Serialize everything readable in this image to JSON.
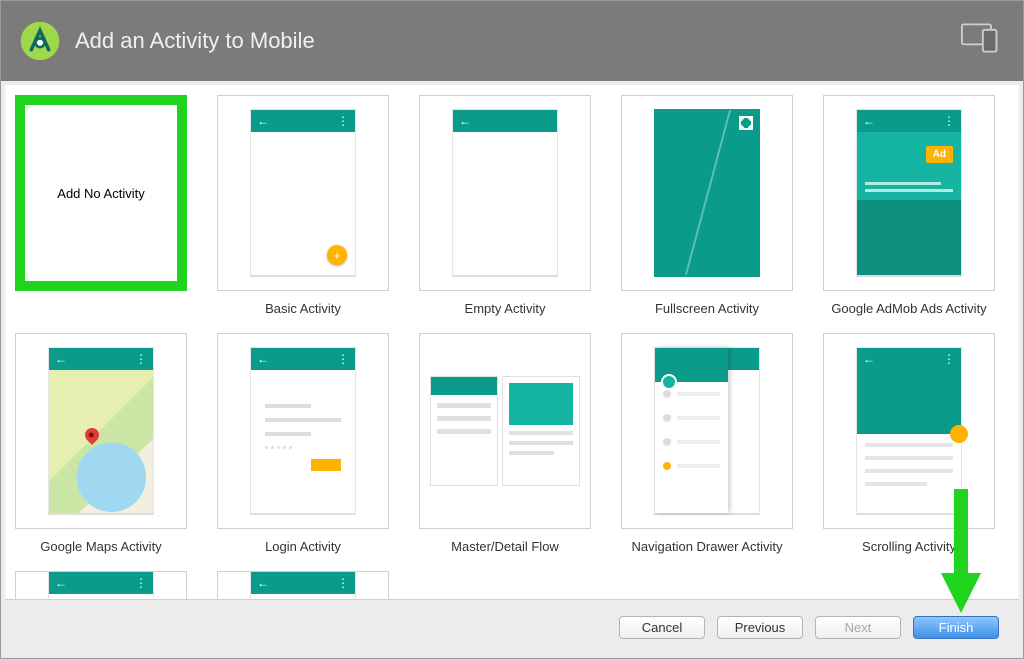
{
  "header": {
    "title": "Add an Activity to Mobile"
  },
  "tiles": [
    {
      "label": "",
      "inside": "Add No Activity",
      "type": "blank",
      "selected": true
    },
    {
      "label": "Basic Activity",
      "type": "basic"
    },
    {
      "label": "Empty Activity",
      "type": "empty"
    },
    {
      "label": "Fullscreen Activity",
      "type": "fullscreen"
    },
    {
      "label": "Google AdMob Ads Activity",
      "type": "admob"
    },
    {
      "label": "Google Maps Activity",
      "type": "maps"
    },
    {
      "label": "Login Activity",
      "type": "login"
    },
    {
      "label": "Master/Detail Flow",
      "type": "md"
    },
    {
      "label": "Navigation Drawer Activity",
      "type": "nav"
    },
    {
      "label": "Scrolling Activity",
      "type": "scroll"
    },
    {
      "label": "",
      "type": "cut"
    },
    {
      "label": "",
      "type": "cut"
    }
  ],
  "buttons": {
    "cancel": "Cancel",
    "previous": "Previous",
    "next": "Next",
    "finish": "Finish"
  }
}
